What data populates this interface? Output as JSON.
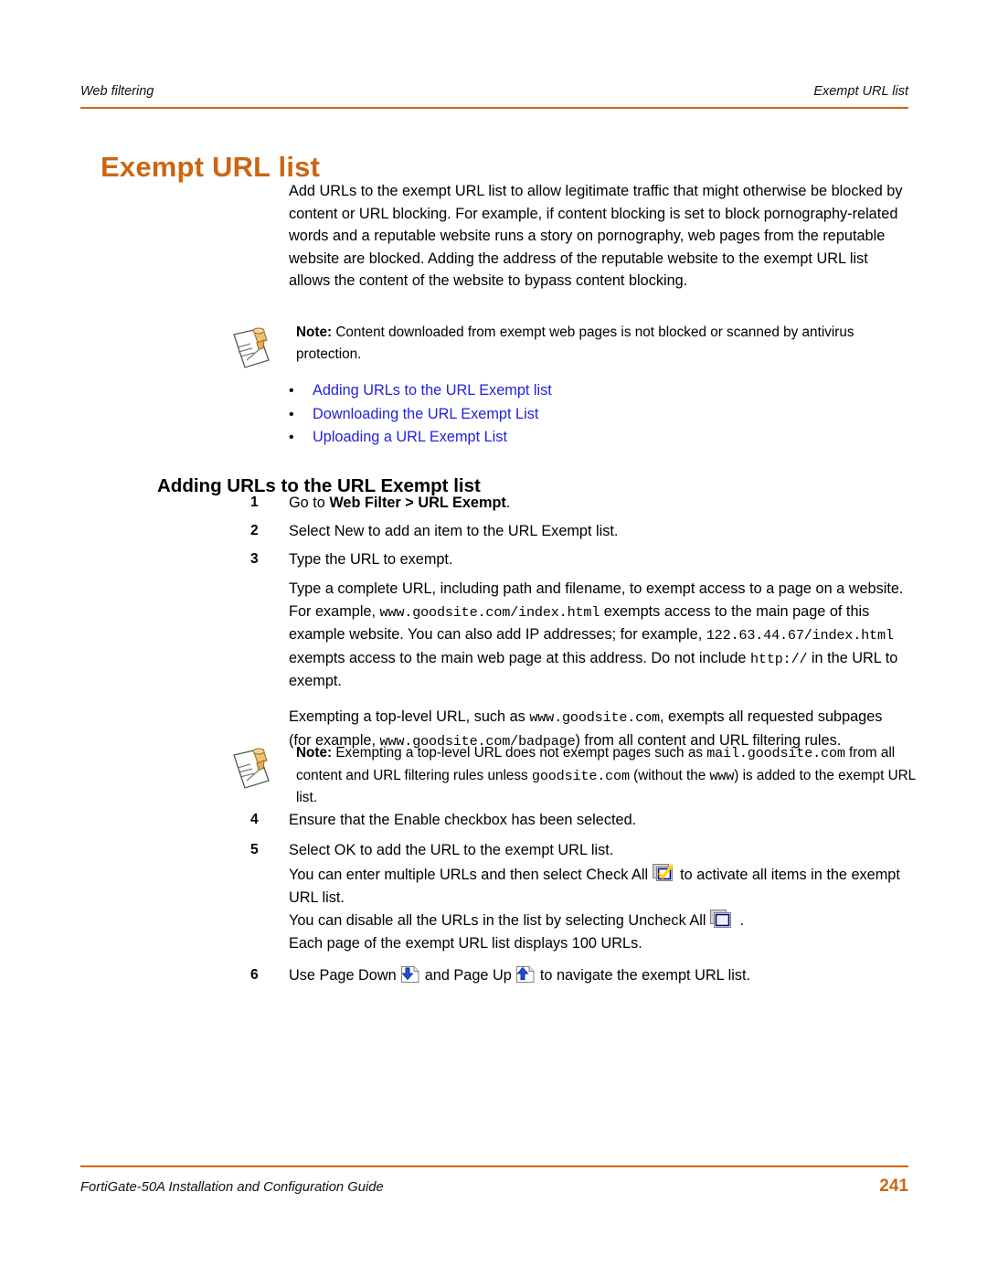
{
  "header": {
    "left": "Web filtering",
    "right": "Exempt URL list",
    "rule_color": "#cc6611"
  },
  "title": {
    "text": "Exempt URL list",
    "color": "#cc6611"
  },
  "intro": {
    "paragraph": "Add URLs to the exempt URL list to allow legitimate traffic that might otherwise be blocked by content or URL blocking. For example, if content blocking is set to block pornography-related words and a reputable website runs a story on pornography, web pages from the reputable website are blocked. Adding the address of the reputable website to the exempt URL list allows the content of the website to bypass content blocking."
  },
  "note1": {
    "icon": "note-pin-icon",
    "label": "Note:",
    "text": " Content downloaded from exempt web pages is not blocked or scanned by antivirus protection."
  },
  "links": {
    "bullet": "•",
    "color": "#2222dd",
    "items": [
      {
        "label": "Adding URLs to the URL Exempt list"
      },
      {
        "label": "Downloading the URL Exempt List"
      },
      {
        "label": "Uploading a URL Exempt List"
      }
    ]
  },
  "section": {
    "heading": "Adding URLs to the URL Exempt list"
  },
  "steps": [
    {
      "num": "1",
      "pre": "Go to ",
      "bold": "Web Filter > URL Exempt",
      "post": "."
    },
    {
      "num": "2",
      "pre": "Select New to add an item to the URL Exempt list.",
      "bold": "",
      "post": ""
    },
    {
      "num": "3",
      "pre": "Type the URL to exempt.",
      "bold": "",
      "post": ""
    }
  ],
  "step3_body": {
    "p1_a": "Type a complete URL, including path and filename, to exempt access to a page on a website. For example, ",
    "p1_mono1": "www.goodsite.com/index.html",
    "p1_b": " exempts access to the main page of this example website. You can also add IP addresses; for example, ",
    "p1_mono2": "122.63.44.67/index.html",
    "p1_c": " exempts access to the main web page at this address. Do not include ",
    "p1_mono3": "http://",
    "p1_d": " in the URL to exempt.",
    "p2_a": "Exempting a top-level URL, such as ",
    "p2_mono1": "www.goodsite.com",
    "p2_b": ", exempts all requested subpages (for example, ",
    "p2_mono2": "www.goodsite.com/badpage",
    "p2_c": ") from all content and URL filtering rules."
  },
  "note2": {
    "icon": "note-pin-icon",
    "label": "Note:",
    "a": " Exempting a top-level URL does not exempt pages such as ",
    "mono1": "mail.goodsite.com",
    "b": " from all content and URL filtering rules unless ",
    "mono2": "goodsite.com",
    "c": " (without the ",
    "mono3": "www",
    "d": ") is added to the exempt URL list."
  },
  "steps2": [
    {
      "num": "4",
      "text": "Ensure that the Enable checkbox has been selected."
    },
    {
      "num": "5",
      "text": "Select OK to add the URL to the exempt URL list."
    }
  ],
  "step5_body": {
    "line1_a": "You can enter multiple URLs and then select Check All",
    "line1_icon": "check-all-icon",
    "line1_b": "to activate all items in the exempt URL list.",
    "line2_a": "You can disable all the URLs in the list by selecting Uncheck All",
    "line2_icon": "uncheck-all-icon",
    "line2_b": ".",
    "line3": "Each page of the exempt URL list displays 100 URLs."
  },
  "step6": {
    "num": "6",
    "a": "Use Page Down",
    "icon_down": "page-down-icon",
    "b": "and Page Up",
    "icon_up": "page-up-icon",
    "c": "to navigate the exempt URL list."
  },
  "footer": {
    "left": "FortiGate-50A Installation and Configuration Guide",
    "page": "241",
    "page_color": "#cc6611"
  }
}
